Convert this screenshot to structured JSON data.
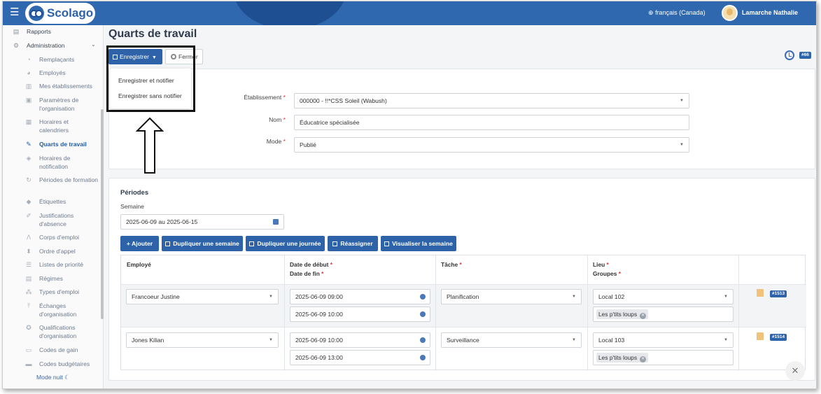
{
  "header": {
    "brand": "Scolago",
    "language": "français (Canada)",
    "user_name": "Lamarche Nathalie"
  },
  "sidebar": {
    "top_items": [
      {
        "label": "Rapports",
        "icon": "report-icon"
      },
      {
        "label": "Administration",
        "icon": "gear-icon"
      }
    ],
    "items": [
      {
        "label": "Remplaçants",
        "icon": "user-icon"
      },
      {
        "label": "Employés",
        "icon": "users-icon"
      },
      {
        "label": "Mes établissements",
        "icon": "building-icon"
      },
      {
        "label": "Paramètres de l'organisation",
        "icon": "settings-icon"
      },
      {
        "label": "Horaires et calendriers",
        "icon": "calendar-icon"
      },
      {
        "label": "Quarts de travail",
        "icon": "edit-icon"
      },
      {
        "label": "Horaires de notification",
        "icon": "bell-icon"
      },
      {
        "label": "Périodes de formation",
        "icon": "refresh-icon"
      },
      {
        "label": "Étiquettes",
        "icon": "tag-icon"
      },
      {
        "label": "Justifications d'absence",
        "icon": "note-icon"
      },
      {
        "label": "Corps d'emploi",
        "icon": "person-icon"
      },
      {
        "label": "Ordre d'appel",
        "icon": "sort-icon"
      },
      {
        "label": "Listes de priorité",
        "icon": "list-icon"
      },
      {
        "label": "Régimes",
        "icon": "grid-icon"
      },
      {
        "label": "Types d'emploi",
        "icon": "hierarchy-icon"
      },
      {
        "label": "Échanges d'organisation",
        "icon": "upload-icon"
      },
      {
        "label": "Qualifications d'organisation",
        "icon": "certificate-icon"
      },
      {
        "label": "Codes de gain",
        "icon": "money-icon"
      },
      {
        "label": "Codes budgétaires",
        "icon": "briefcase-icon"
      }
    ],
    "active_item": "Quarts de travail",
    "night_mode": "Mode nuit",
    "night_icon": "☾"
  },
  "page": {
    "title": "Quarts de travail",
    "save_label": "Enregistrer",
    "close_label": "Fermer",
    "record_badge": "#66"
  },
  "save_menu": {
    "items": [
      "Enregistrer et notifier",
      "Enregistrer sans notifier"
    ]
  },
  "form": {
    "establishment_label": "Établissement",
    "establishment_value": "000000 - !!*CSS Soleil (Wabush)",
    "name_label": "Nom",
    "name_value": "Éducatrice spécialisée",
    "mode_label": "Mode",
    "mode_value": "Publié",
    "required_mark": "*"
  },
  "periods": {
    "title": "Périodes",
    "week_label": "Semaine",
    "week_value": "2025-06-09 au 2025-06-15",
    "buttons": [
      "+ Ajouter",
      "Dupliquer une semaine",
      "Dupliquer une journée",
      "Réassigner",
      "Visualiser la semaine"
    ],
    "columns": {
      "employee": "Employé",
      "start": "Date de début",
      "end": "Date de fin",
      "task": "Tâche",
      "place": "Lieu",
      "groups": "Groupes"
    },
    "rows": [
      {
        "employee": "Francoeur Justine",
        "start": "2025-06-09 09:00",
        "end": "2025-06-09 10:00",
        "task": "Planification",
        "place": "Local 102",
        "group": "Les p'tits loups",
        "id": "#1513"
      },
      {
        "employee": "Jones Kilian",
        "start": "2025-06-09 10:00",
        "end": "2025-06-09 13:00",
        "task": "Surveillance",
        "place": "Local 103",
        "group": "Les p'tits loups",
        "id": "#1514"
      }
    ]
  },
  "colors": {
    "brand_blue": "#3068b0",
    "button_blue": "#2f63a9",
    "required_red": "#dd3333"
  }
}
